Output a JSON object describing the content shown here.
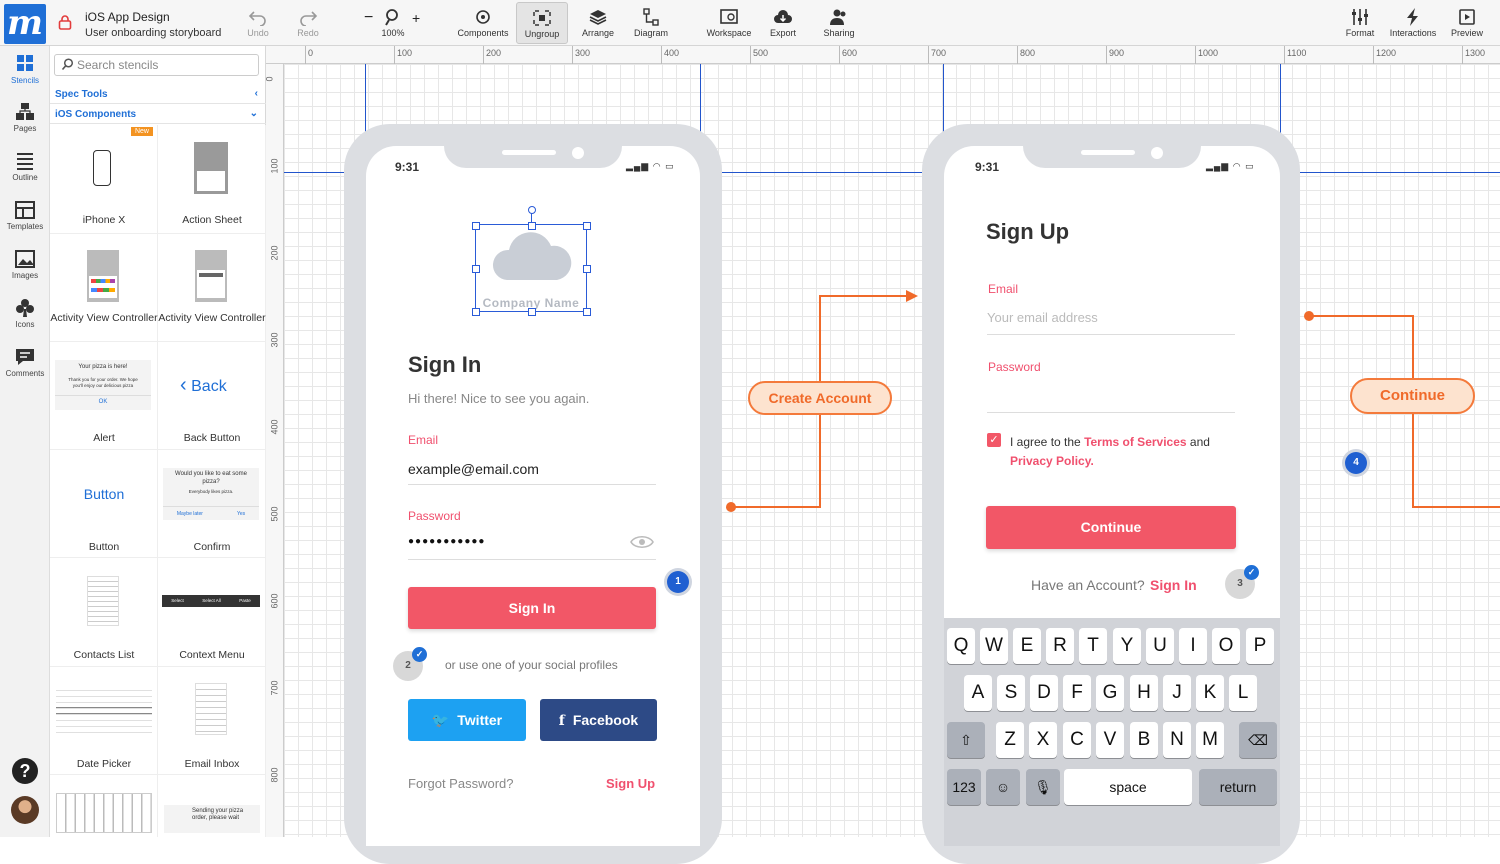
{
  "app": {
    "project_title": "iOS App Design",
    "project_subtitle": "User onboarding storyboard"
  },
  "toolbar": {
    "undo": "Undo",
    "redo": "Redo",
    "zoom": "100%",
    "zoom_minus": "−",
    "zoom_plus": "+",
    "components": "Components",
    "ungroup": "Ungroup",
    "arrange": "Arrange",
    "diagram": "Diagram",
    "workspace": "Workspace",
    "export": "Export",
    "sharing": "Sharing",
    "format": "Format",
    "interactions": "Interactions",
    "preview": "Preview"
  },
  "rail": {
    "stencils": "Stencils",
    "pages": "Pages",
    "outline": "Outline",
    "templates": "Templates",
    "images": "Images",
    "icons": "Icons",
    "comments": "Comments",
    "help": "?"
  },
  "panel": {
    "search_placeholder": "Search stencils",
    "spec_tools": "Spec Tools",
    "ios_components": "iOS Components",
    "new_badge": "New",
    "items": {
      "iphone_x": "iPhone X",
      "action_sheet": "Action Sheet",
      "activity_view_1": "Activity View Controller",
      "activity_view_2": "Activity View Controller",
      "alert": "Alert",
      "back_button": "Back Button",
      "button": "Button",
      "confirm": "Confirm",
      "contacts_list": "Contacts List",
      "context_menu": "Context Menu",
      "date_picker": "Date Picker",
      "email_inbox": "Email Inbox"
    },
    "previews": {
      "back_text": "Back",
      "button_text": "Button",
      "alert_title": "Your pizza is here!",
      "alert_body": "Thank you for your order. We hope you'll enjoy our delicious pizza",
      "alert_ok": "OK",
      "confirm_title": "Would you like to eat some pizza?",
      "confirm_body": "Everybody likes pizza.",
      "confirm_no": "Maybe later",
      "confirm_yes": "Yes",
      "context_items": [
        "Select",
        "Select All",
        "Paste"
      ],
      "bottom_text": "Sending your pizza order, please wait"
    }
  },
  "ruler": {
    "top": [
      "0",
      "100",
      "200",
      "300",
      "400",
      "500",
      "600",
      "700",
      "800",
      "900",
      "1000",
      "1100",
      "1200",
      "1300"
    ],
    "left": [
      "0",
      "100",
      "200",
      "300",
      "400",
      "500",
      "600",
      "700",
      "800"
    ]
  },
  "signin": {
    "time": "9:31",
    "company_name": "Company Name",
    "title": "Sign In",
    "subtitle": "Hi there! Nice to see you again.",
    "email_label": "Email",
    "email_value": "example@email.com",
    "password_label": "Password",
    "password_value": "●●●●●●●●●●●",
    "button": "Sign In",
    "social_text": "or use one of your social profiles",
    "twitter": "Twitter",
    "facebook": "Facebook",
    "forgot": "Forgot Password?",
    "signup_link": "Sign Up"
  },
  "signup": {
    "time": "9:31",
    "title": "Sign Up",
    "email_label": "Email",
    "email_placeholder": "Your email address",
    "password_label": "Password",
    "agree_prefix": "I agree to the ",
    "terms": "Terms of Services",
    "agree_and": " and",
    "privacy": "Privacy Policy.",
    "button": "Continue",
    "have_account": "Have an Account?",
    "signin_link": "Sign In"
  },
  "flow": {
    "create_account": "Create Account",
    "continue": "Continue",
    "badges": [
      "1",
      "2",
      "3",
      "4"
    ]
  },
  "keyboard": {
    "row1": [
      "Q",
      "W",
      "E",
      "R",
      "T",
      "Y",
      "U",
      "I",
      "O",
      "P"
    ],
    "row2": [
      "A",
      "S",
      "D",
      "F",
      "G",
      "H",
      "J",
      "K",
      "L"
    ],
    "row3": [
      "Z",
      "X",
      "C",
      "V",
      "B",
      "N",
      "M"
    ],
    "num": "123",
    "space": "space",
    "return": "return"
  },
  "colors": {
    "brand": "#1f6fd6",
    "accent_red": "#f25767",
    "flow_orange": "#f06a2a",
    "twitter": "#1da1f2",
    "facebook": "#2d4a86"
  }
}
